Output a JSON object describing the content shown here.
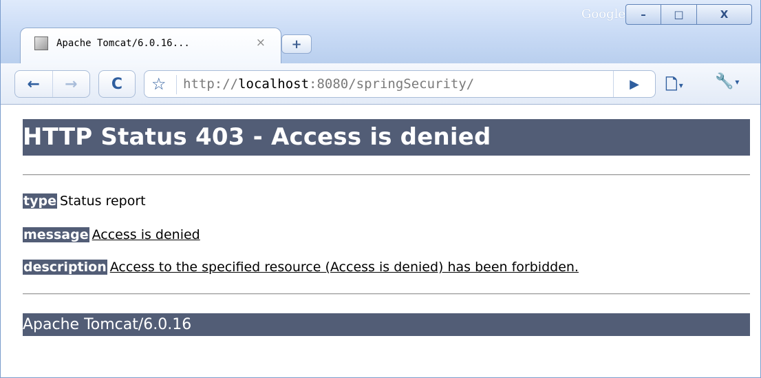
{
  "window": {
    "brand": "Google",
    "controls": {
      "minimize": "–",
      "maximize": "□",
      "close": "X"
    }
  },
  "tabs": [
    {
      "title": "Apache Tomcat/6.0.16...",
      "close": "×",
      "icon": "tomcat-favicon-icon",
      "active": true
    }
  ],
  "new_tab": "+",
  "toolbar": {
    "back": "←",
    "forward": "→",
    "reload": "C",
    "bookmark_star": "☆",
    "url_scheme": "http://",
    "url_host": "localhost",
    "url_rest": ":8080/springSecurity/",
    "go": "▶",
    "page_menu": "🗋",
    "page_menu_caret": "▾",
    "tools_menu": "🔧",
    "tools_menu_caret": "▾"
  },
  "content": {
    "heading": "HTTP Status 403 - Access is denied",
    "type_label": "type",
    "type_value": "Status report",
    "message_label": "message",
    "message_value": "Access is denied",
    "description_label": "description",
    "description_value": "Access to the specified resource (Access is denied) has been forbidden.",
    "footer": "Apache Tomcat/6.0.16"
  },
  "colors": {
    "tomcat_bar": "#525d76",
    "chrome_blue": "#2f5e9e"
  }
}
